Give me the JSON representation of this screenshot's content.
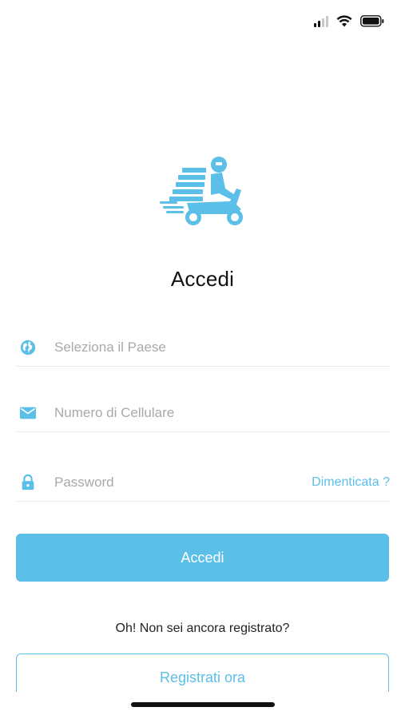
{
  "colors": {
    "accent": "#5bbfe8",
    "text": "#111111",
    "placeholder": "#a9a9a9",
    "divider": "#ececec"
  },
  "status_bar": {
    "icons": [
      "cellular-signal-icon",
      "wifi-icon",
      "battery-icon"
    ]
  },
  "logo": {
    "icon": "scooter-delivery-icon"
  },
  "title": "Accedi",
  "form": {
    "country": {
      "icon": "globe-icon",
      "placeholder": "Seleziona il Paese",
      "value": ""
    },
    "phone": {
      "icon": "mail-icon",
      "placeholder": "Numero di Cellulare",
      "value": ""
    },
    "password": {
      "icon": "lock-icon",
      "placeholder": "Password",
      "value": "",
      "forgot_label": "Dimenticata ?"
    }
  },
  "login_button_label": "Accedi",
  "register_prompt": "Oh! Non sei ancora registrato?",
  "register_button_label": "Registrati ora"
}
